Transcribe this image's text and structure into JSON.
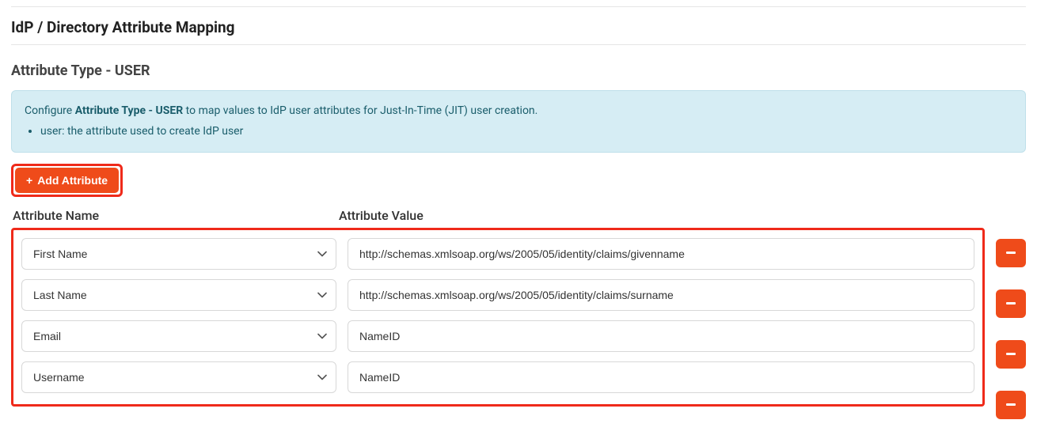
{
  "page": {
    "title": "IdP / Directory Attribute Mapping"
  },
  "section": {
    "title": "Attribute Type - USER"
  },
  "info": {
    "prefix": "Configure ",
    "bold": "Attribute Type - USER",
    "suffix": " to map values to IdP user attributes for Just-In-Time (JIT) user creation.",
    "bullets": [
      "user: the attribute used to create IdP user"
    ]
  },
  "buttons": {
    "add": "Add Attribute"
  },
  "headers": {
    "name": "Attribute Name",
    "value": "Attribute Value"
  },
  "rows": [
    {
      "name": "First Name",
      "value": "http://schemas.xmlsoap.org/ws/2005/05/identity/claims/givenname"
    },
    {
      "name": "Last Name",
      "value": "http://schemas.xmlsoap.org/ws/2005/05/identity/claims/surname"
    },
    {
      "name": "Email",
      "value": "NameID"
    },
    {
      "name": "Username",
      "value": "NameID"
    }
  ],
  "colors": {
    "accent": "#ef4b1a",
    "highlight_border": "#ef2a1a",
    "info_bg": "#d6edf4"
  }
}
